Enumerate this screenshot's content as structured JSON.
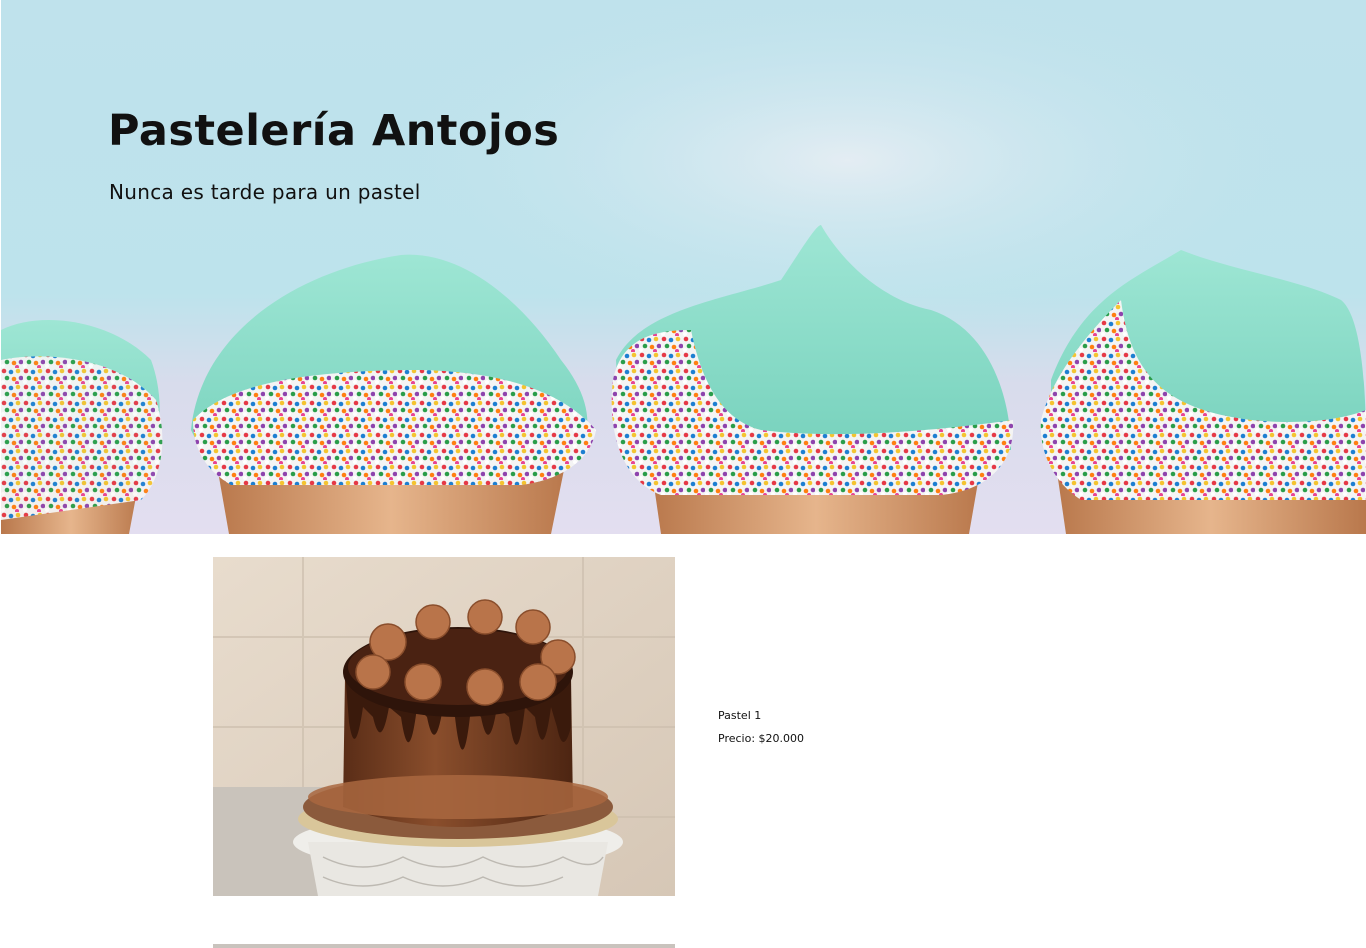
{
  "hero": {
    "title": "Pastelería Antojos",
    "subtitle": "Nunca es tarde para un pastel",
    "image": "cupcakes-banner-photo",
    "colors": {
      "sky": "#bfe2ec",
      "frosting": "#8fdcc8",
      "wrapper": "#d9a47a"
    }
  },
  "products": [
    {
      "image": "chocolate-cake-photo",
      "name": "Pastel 1",
      "price_label": "Precio:",
      "price_value": "$20.000"
    }
  ]
}
